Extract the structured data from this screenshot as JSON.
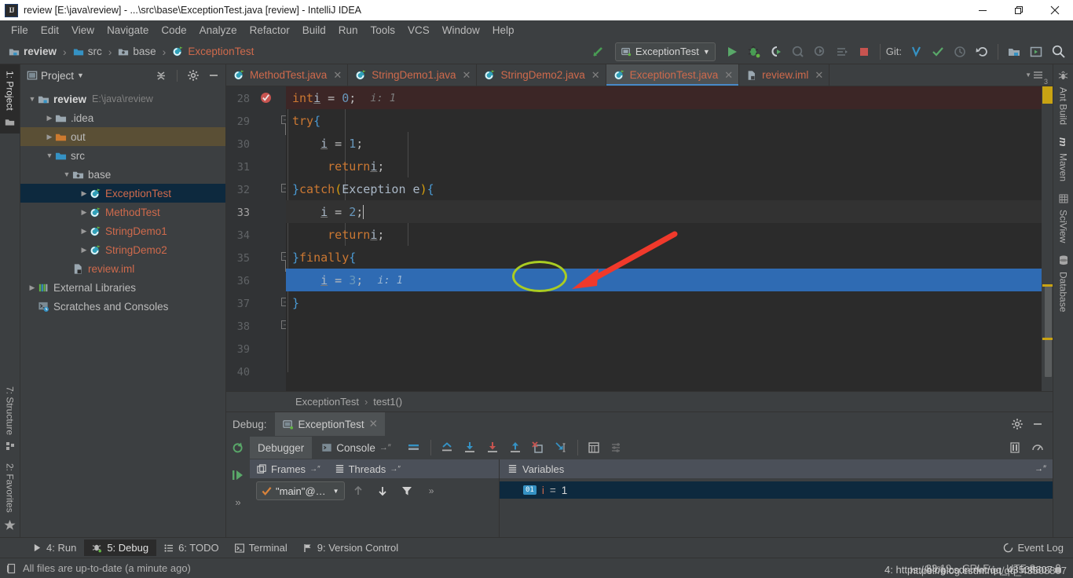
{
  "window": {
    "title": "review [E:\\java\\review] - ...\\src\\base\\ExceptionTest.java [review] - IntelliJ IDEA",
    "logo_text": "IJ",
    "minimize": "—",
    "maximize": "❐",
    "close": "✕"
  },
  "menubar": {
    "items": [
      {
        "label": "File"
      },
      {
        "label": "Edit"
      },
      {
        "label": "View"
      },
      {
        "label": "Navigate"
      },
      {
        "label": "Code"
      },
      {
        "label": "Analyze"
      },
      {
        "label": "Refactor"
      },
      {
        "label": "Build"
      },
      {
        "label": "Run"
      },
      {
        "label": "Tools"
      },
      {
        "label": "VCS"
      },
      {
        "label": "Window"
      },
      {
        "label": "Help"
      }
    ]
  },
  "navbar": {
    "breadcrumbs": [
      {
        "label": "review",
        "icon": "module-icon"
      },
      {
        "label": "src",
        "icon": "source-folder-icon"
      },
      {
        "label": "base",
        "icon": "package-icon"
      },
      {
        "label": "ExceptionTest",
        "icon": "java-class-icon"
      }
    ],
    "separator": "›",
    "run_config": "ExceptionTest",
    "git_label": "Git:",
    "icons": [
      "build-icon",
      "run-icon",
      "debug-icon",
      "run-with-coverage-icon",
      "profile-icon",
      "attach-icon",
      "step-icon",
      "stop-icon",
      "git-update-icon",
      "git-commit-icon",
      "git-history-icon",
      "git-rollback-icon",
      "project-structure-icon",
      "run-anything-icon",
      "search-everywhere-icon"
    ]
  },
  "left_strip": {
    "tabs": [
      {
        "label": "1: Project",
        "icon": "project-folder-icon",
        "active": true
      },
      {
        "label": "7: Structure",
        "icon": "structure-icon",
        "active": false
      },
      {
        "label": "2: Favorites",
        "icon": "star-icon",
        "active": false
      }
    ]
  },
  "right_strip": {
    "tabs": [
      {
        "label": "Ant Build",
        "icon": "ant-icon"
      },
      {
        "label": "Maven",
        "icon": "maven-icon"
      },
      {
        "label": "SciView",
        "icon": "sciview-icon"
      },
      {
        "label": "Database",
        "icon": "database-icon"
      }
    ]
  },
  "project_pane": {
    "title": "Project",
    "dropdown_caret": "▾",
    "tree": [
      {
        "label": "review",
        "sub": "E:\\java\\review",
        "depth": 0,
        "arrow": "▼",
        "icon": "module-icon",
        "style": "bold",
        "state": "normal"
      },
      {
        "label": ".idea",
        "sub": "",
        "depth": 1,
        "arrow": "▶",
        "icon": "folder-icon",
        "style": "",
        "state": "normal"
      },
      {
        "label": "out",
        "sub": "",
        "depth": 1,
        "arrow": "▶",
        "icon": "out-folder-icon",
        "style": "",
        "state": "highlight"
      },
      {
        "label": "src",
        "sub": "",
        "depth": 1,
        "arrow": "▼",
        "icon": "source-folder-icon",
        "style": "",
        "state": "normal"
      },
      {
        "label": "base",
        "sub": "",
        "depth": 2,
        "arrow": "▼",
        "icon": "package-icon",
        "style": "",
        "state": "normal"
      },
      {
        "label": "ExceptionTest",
        "sub": "",
        "depth": 3,
        "arrow": "▶",
        "icon": "java-class-icon",
        "style": "red",
        "state": "selected"
      },
      {
        "label": "MethodTest",
        "sub": "",
        "depth": 3,
        "arrow": "▶",
        "icon": "java-class-icon",
        "style": "red",
        "state": "normal"
      },
      {
        "label": "StringDemo1",
        "sub": "",
        "depth": 3,
        "arrow": "▶",
        "icon": "java-class-icon",
        "style": "red",
        "state": "normal"
      },
      {
        "label": "StringDemo2",
        "sub": "",
        "depth": 3,
        "arrow": "▶",
        "icon": "java-class-icon",
        "style": "red",
        "state": "normal"
      },
      {
        "label": "review.iml",
        "sub": "",
        "depth": 2,
        "arrow": "",
        "icon": "iml-file-icon",
        "style": "red",
        "state": "normal"
      },
      {
        "label": "External Libraries",
        "sub": "",
        "depth": 0,
        "arrow": "▶",
        "icon": "libraries-icon",
        "style": "",
        "state": "normal"
      },
      {
        "label": "Scratches and Consoles",
        "sub": "",
        "depth": 0,
        "arrow": "",
        "icon": "scratches-icon",
        "style": "",
        "state": "normal"
      }
    ]
  },
  "editor": {
    "tabs": [
      {
        "label": "MethodTest.java",
        "active": false,
        "icon": "java-class-icon",
        "close": "✕"
      },
      {
        "label": "StringDemo1.java",
        "active": false,
        "icon": "java-class-icon",
        "close": "✕"
      },
      {
        "label": "StringDemo2.java",
        "active": false,
        "icon": "java-class-icon",
        "close": "✕"
      },
      {
        "label": "ExceptionTest.java",
        "active": true,
        "icon": "java-class-icon",
        "close": "✕"
      },
      {
        "label": "review.iml",
        "active": false,
        "icon": "iml-file-icon",
        "close": "✕"
      }
    ],
    "tab_overflow": "3",
    "line_numbers": [
      "28",
      "29",
      "30",
      "31",
      "32",
      "33",
      "34",
      "35",
      "36",
      "37",
      "38",
      "39",
      "40"
    ],
    "lines": [
      {
        "n": "28",
        "state": "breakpoint",
        "tokens": [
          {
            "t": "        ",
            "c": ""
          },
          {
            "t": "int",
            "c": "kw"
          },
          {
            "t": " ",
            "c": ""
          },
          {
            "t": "i",
            "c": "var"
          },
          {
            "t": " = ",
            "c": "typ"
          },
          {
            "t": "0",
            "c": "num"
          },
          {
            "t": ";",
            "c": "typ"
          },
          {
            "t": "   i: 1",
            "c": "hint"
          }
        ]
      },
      {
        "n": "29",
        "state": "",
        "tokens": [
          {
            "t": "        ",
            "c": ""
          },
          {
            "t": "try",
            "c": "kw"
          },
          {
            "t": " ",
            "c": ""
          },
          {
            "t": "{",
            "c": "br1"
          }
        ]
      },
      {
        "n": "30",
        "state": "",
        "tokens": [
          {
            "t": "            ",
            "c": ""
          },
          {
            "t": "i",
            "c": "var"
          },
          {
            "t": " = ",
            "c": "typ"
          },
          {
            "t": "1",
            "c": "num"
          },
          {
            "t": ";",
            "c": "typ"
          }
        ]
      },
      {
        "n": "31",
        "state": "",
        "tokens": [
          {
            "t": "             ",
            "c": ""
          },
          {
            "t": "return",
            "c": "kw"
          },
          {
            "t": " ",
            "c": ""
          },
          {
            "t": "i",
            "c": "var"
          },
          {
            "t": ";",
            "c": "typ"
          }
        ]
      },
      {
        "n": "32",
        "state": "",
        "tokens": [
          {
            "t": "        ",
            "c": ""
          },
          {
            "t": "}",
            "c": "br1"
          },
          {
            "t": " ",
            "c": ""
          },
          {
            "t": "catch",
            "c": "kw"
          },
          {
            "t": " ",
            "c": ""
          },
          {
            "t": "(",
            "c": "br3"
          },
          {
            "t": "Exception",
            "c": "typ"
          },
          {
            "t": " e",
            "c": "typ"
          },
          {
            "t": ")",
            "c": "br3"
          },
          {
            "t": " ",
            "c": ""
          },
          {
            "t": "{",
            "c": "br1"
          }
        ]
      },
      {
        "n": "33",
        "state": "current",
        "tokens": [
          {
            "t": "            ",
            "c": ""
          },
          {
            "t": "i",
            "c": "var"
          },
          {
            "t": " = ",
            "c": "typ"
          },
          {
            "t": "2",
            "c": "num"
          },
          {
            "t": ";",
            "c": "typ"
          }
        ]
      },
      {
        "n": "34",
        "state": "",
        "tokens": [
          {
            "t": "             ",
            "c": ""
          },
          {
            "t": "return",
            "c": "kw"
          },
          {
            "t": " ",
            "c": ""
          },
          {
            "t": "i",
            "c": "var"
          },
          {
            "t": ";",
            "c": "typ"
          }
        ]
      },
      {
        "n": "35",
        "state": "",
        "tokens": [
          {
            "t": "        ",
            "c": ""
          },
          {
            "t": "}",
            "c": "br1"
          },
          {
            "t": "finally",
            "c": "kw"
          },
          {
            "t": " ",
            "c": ""
          },
          {
            "t": "{",
            "c": "br1"
          }
        ]
      },
      {
        "n": "36",
        "state": "executing",
        "tokens": [
          {
            "t": "            ",
            "c": ""
          },
          {
            "t": "i",
            "c": "var"
          },
          {
            "t": " = ",
            "c": "typ"
          },
          {
            "t": "3",
            "c": "num"
          },
          {
            "t": ";",
            "c": "typ"
          },
          {
            "t": "   i: 1",
            "c": "hint"
          }
        ]
      },
      {
        "n": "37",
        "state": "",
        "tokens": [
          {
            "t": "        ",
            "c": ""
          },
          {
            "t": "}",
            "c": "br1"
          }
        ]
      },
      {
        "n": "38",
        "state": "",
        "tokens": [
          {
            "t": "    ",
            "c": ""
          },
          {
            "t": "}",
            "c": "br2"
          }
        ]
      },
      {
        "n": "39",
        "state": "",
        "tokens": [
          {
            "t": "",
            "c": ""
          },
          {
            "t": "}",
            "c": "br3"
          }
        ]
      },
      {
        "n": "40",
        "state": "",
        "tokens": []
      }
    ],
    "bottom_breadcrumb": {
      "class": "ExceptionTest",
      "method": "test1()",
      "separator": "›"
    }
  },
  "debug": {
    "label": "Debug:",
    "session_tab": "ExceptionTest",
    "session_close": "✕",
    "tabs": [
      {
        "label": "Debugger",
        "active": true,
        "icon": ""
      },
      {
        "label": "Console",
        "active": false,
        "icon": "console-icon",
        "pin": "→″"
      }
    ],
    "toolbar_icons": [
      "mute-breakpoints-icon",
      "show-execution-point-icon",
      "step-over-icon",
      "step-into-icon",
      "force-step-into-icon",
      "step-out-icon",
      "drop-frame-icon",
      "run-to-cursor-icon",
      "evaluate-expression-icon",
      "layout-settings-icon"
    ],
    "right_icons": [
      "watches-icon",
      "throttle-icon"
    ],
    "left_icons": [
      "rerun-icon",
      "resume-icon",
      "more-icon"
    ],
    "subtabs": [
      {
        "label": "Frames",
        "icon": "frames-icon",
        "pin": "→″"
      },
      {
        "label": "Threads",
        "icon": "threads-icon",
        "pin": "→″"
      }
    ],
    "variables_title": "Variables",
    "variables_icon": "variables-icon",
    "thread_selector": "\"main\"@…",
    "frames_icons": [
      "up-icon",
      "down-icon",
      "filter-icon",
      "more-icon"
    ],
    "variables": [
      {
        "badge": "01",
        "name": "i",
        "eq": "=",
        "value": "1"
      }
    ],
    "settings_icon": "gear-icon",
    "hide_icon": "minimize-icon"
  },
  "bottom_tabs": {
    "items": [
      {
        "label": "4: Run",
        "icon": "run-icon",
        "active": false
      },
      {
        "label": "5: Debug",
        "icon": "debug-icon",
        "active": true
      },
      {
        "label": "6: TODO",
        "icon": "todo-icon",
        "active": false
      },
      {
        "label": "Terminal",
        "icon": "terminal-icon",
        "active": false
      },
      {
        "label": "9: Version Control",
        "icon": "vcs-icon",
        "active": false
      }
    ],
    "event_log": "Event Log",
    "event_log_icon": "event-log-icon"
  },
  "statusbar": {
    "message": "All files are up-to-date (a minute ago)",
    "message_icon": "files-icon",
    "caret_position": "33:19",
    "line_separator": "CRLF",
    "encoding": "UTF-8",
    "selector_caret": "↕",
    "watermark": "https://blog.csdn.net/qq_43508807",
    "watermark_overlay": "4: https://blog.csdn.net/qq_43508807"
  },
  "colors": {
    "accent_blue": "#4a88c7",
    "executing_line": "#2f6bb3",
    "breakpoint_red": "#c75450",
    "annotation_green": "#aacc22",
    "annotation_arrow_red": "#f0392b",
    "keyword_orange": "#cc7832",
    "number_blue": "#6897bb",
    "class_red": "#cf6a4c",
    "panel_bg": "#3c3f41",
    "editor_bg": "#2b2b2b"
  }
}
